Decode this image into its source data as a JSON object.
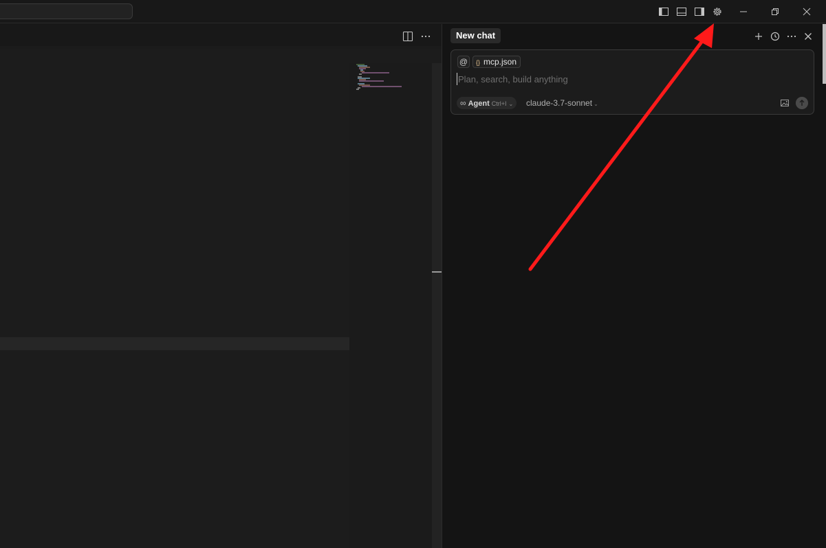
{
  "titlebar": {
    "icons": [
      "toggle-primary-sidebar-icon",
      "toggle-panel-icon",
      "toggle-secondary-sidebar-icon",
      "settings-gear-icon"
    ],
    "window_controls": [
      "minimize-icon",
      "restore-icon",
      "close-icon"
    ]
  },
  "editor": {
    "actions": [
      "split-editor-icon",
      "more-actions-icon"
    ]
  },
  "chat": {
    "tab_label": "New chat",
    "header_actions": [
      "new-chat-icon",
      "history-icon",
      "more-icon",
      "close-icon"
    ],
    "context": {
      "at_symbol": "@",
      "file_icon_glyph": "{}",
      "file_name": "mcp.json"
    },
    "input_placeholder": "Plan, search, build anything",
    "mode": {
      "icon_glyph": "∞",
      "label": "Agent",
      "shortcut": "Ctrl+I"
    },
    "model": "claude-3.7-sonnet"
  },
  "annotation": {
    "arrow_color": "#ff1a1a"
  }
}
